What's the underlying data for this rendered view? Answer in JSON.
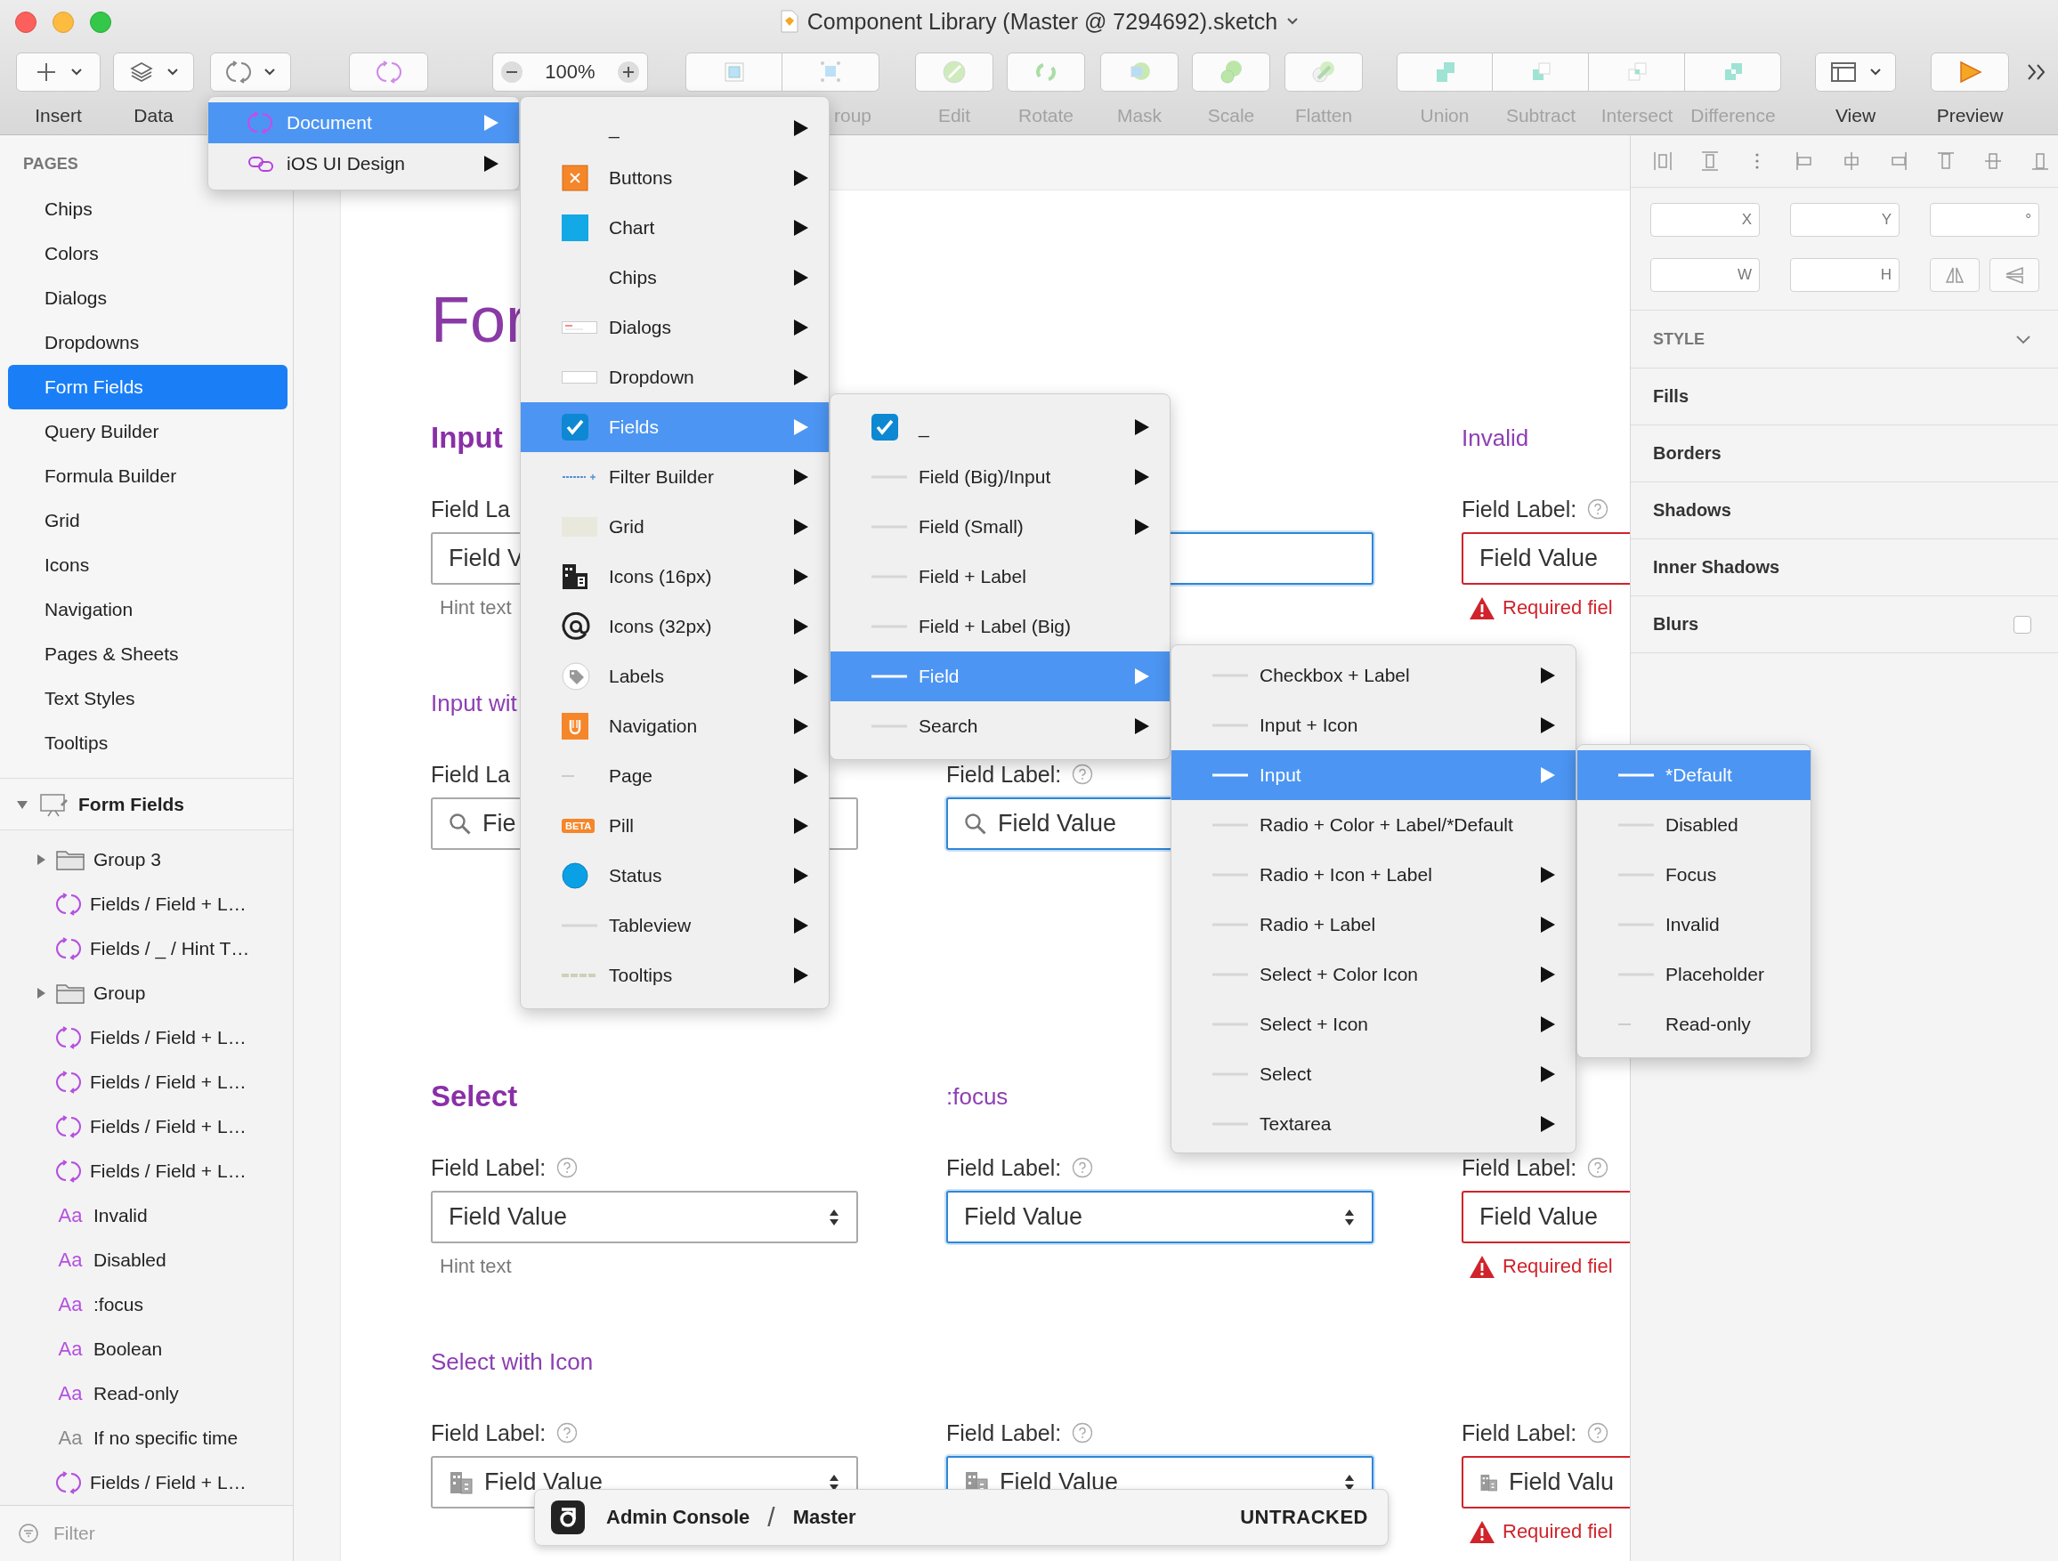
{
  "window": {
    "title": "Component Library (Master @ 7294692).sketch"
  },
  "toolbar": [
    {
      "kind": "dropdown",
      "label": "Insert",
      "disabled": false
    },
    {
      "kind": "dropdown",
      "label": "Data",
      "disabled": false
    },
    {
      "kind": "dropdown",
      "disabled": false
    },
    {
      "kind": "button",
      "disabled": false
    },
    {
      "kind": "zoom",
      "value": "100%",
      "disabled": false
    },
    {
      "kind": "pair",
      "label": "roup",
      "disabled": true
    },
    {
      "kind": "button",
      "label": "Edit",
      "disabled": true
    },
    {
      "kind": "button",
      "label": "Rotate",
      "disabled": true
    },
    {
      "kind": "button",
      "label": "Mask",
      "disabled": true
    },
    {
      "kind": "button",
      "label": "Scale",
      "disabled": true
    },
    {
      "kind": "button",
      "label": "Flatten",
      "disabled": true
    },
    {
      "kind": "segmented",
      "items": [
        {
          "label": "Union",
          "disabled": true
        },
        {
          "label": "Subtract",
          "disabled": true
        },
        {
          "label": "Intersect",
          "disabled": true
        },
        {
          "label": "Difference",
          "disabled": true
        }
      ]
    },
    {
      "kind": "dropdown",
      "label": "View",
      "disabled": false
    },
    {
      "kind": "button",
      "label": "Preview",
      "disabled": false
    },
    {
      "kind": "overflow"
    }
  ],
  "sidebar": {
    "pages_title": "PAGES",
    "pages": [
      {
        "label": "Chips",
        "selected": false
      },
      {
        "label": "Colors",
        "selected": false
      },
      {
        "label": "Dialogs",
        "selected": false
      },
      {
        "label": "Dropdowns",
        "selected": false
      },
      {
        "label": "Form Fields",
        "selected": true
      },
      {
        "label": "Query Builder",
        "selected": false
      },
      {
        "label": "Formula Builder",
        "selected": false
      },
      {
        "label": "Grid",
        "selected": false
      },
      {
        "label": "Icons",
        "selected": false
      },
      {
        "label": "Navigation",
        "selected": false
      },
      {
        "label": "Pages & Sheets",
        "selected": false
      },
      {
        "label": "Text Styles",
        "selected": false
      },
      {
        "label": "Tooltips",
        "selected": false
      }
    ],
    "layers": {
      "label": "Form Fields",
      "expanded": true,
      "children": [
        {
          "kind": "group",
          "label": "Group 3",
          "expanded": false
        },
        {
          "kind": "symbol",
          "label": "Fields / Field + L…"
        },
        {
          "kind": "symbol",
          "label": "Fields / _ / Hint T…"
        },
        {
          "kind": "group",
          "label": "Group",
          "expanded": false
        },
        {
          "kind": "symbol",
          "label": "Fields / Field + L…"
        },
        {
          "kind": "symbol",
          "label": "Fields / Field + L…"
        },
        {
          "kind": "symbol",
          "label": "Fields / Field + L…"
        },
        {
          "kind": "symbol",
          "label": "Fields / Field + L…"
        },
        {
          "kind": "text",
          "glyph": "Aa",
          "label": "Invalid",
          "dimmed": false
        },
        {
          "kind": "text",
          "glyph": "Aa",
          "label": "Disabled",
          "dimmed": false
        },
        {
          "kind": "text",
          "glyph": "Aa",
          "label": ":focus",
          "dimmed": false
        },
        {
          "kind": "text",
          "glyph": "Aa",
          "label": "Boolean",
          "dimmed": false
        },
        {
          "kind": "text",
          "glyph": "Aa",
          "label": "Read-only",
          "dimmed": false
        },
        {
          "kind": "text",
          "glyph": "Aa",
          "label": "If no specific time",
          "dimmed": true
        },
        {
          "kind": "symbol",
          "label": "Fields / Field + L…"
        }
      ]
    },
    "filter": {
      "placeholder": "Filter"
    }
  },
  "canvas": {
    "title": "For",
    "rows": [
      {
        "kind": "heading",
        "cells": [
          {
            "kind": "heading",
            "text": "Input"
          },
          {
            "kind": "blank"
          },
          {
            "kind": "subheading",
            "text": "Invalid"
          }
        ]
      },
      {
        "kind": "label",
        "cells": [
          {
            "kind": "label",
            "text": "Field La",
            "help": false
          },
          {
            "kind": "blank"
          },
          {
            "kind": "label",
            "text": "Field Label:",
            "help": true
          }
        ]
      },
      {
        "kind": "field",
        "cells": [
          {
            "kind": "input",
            "value": "Field V",
            "focus": false,
            "invalid": false
          },
          {
            "kind": "input",
            "focus": true,
            "invalid": false
          },
          {
            "kind": "input",
            "value": "Field Value",
            "focus": false,
            "invalid": true
          }
        ]
      },
      {
        "kind": "hint",
        "cells": [
          {
            "kind": "hint",
            "text": "Hint text"
          },
          {
            "kind": "blank"
          },
          {
            "kind": "error",
            "text": "Required fiel"
          }
        ]
      },
      {
        "kind": "heading",
        "cells": [
          {
            "kind": "subheading",
            "text": "Input wit"
          },
          {
            "kind": "blank"
          },
          {
            "kind": "blank"
          }
        ]
      },
      {
        "kind": "label",
        "cells": [
          {
            "kind": "label",
            "text": "Field La",
            "help": false
          },
          {
            "kind": "label",
            "text": "Field Label:",
            "help": true
          },
          {
            "kind": "blank"
          }
        ]
      },
      {
        "kind": "field",
        "cells": [
          {
            "kind": "search",
            "value": "Fie",
            "focus": false,
            "invalid": false
          },
          {
            "kind": "search",
            "value": "Field Value",
            "focus": true,
            "invalid": false
          },
          {
            "kind": "blank"
          }
        ]
      },
      {
        "kind": "heading",
        "cells": [
          {
            "kind": "heading",
            "text": "Select"
          },
          {
            "kind": "subheading",
            "text": ":focus"
          },
          {
            "kind": "blank"
          }
        ]
      },
      {
        "kind": "label",
        "cells": [
          {
            "kind": "label",
            "text": "Field Label:",
            "help": true
          },
          {
            "kind": "label",
            "text": "Field Label:",
            "help": true
          },
          {
            "kind": "label",
            "text": "Field Label:",
            "help": true
          }
        ]
      },
      {
        "kind": "field",
        "cells": [
          {
            "kind": "select",
            "value": "Field Value",
            "focus": false,
            "invalid": false
          },
          {
            "kind": "select",
            "value": "Field Value",
            "focus": true,
            "invalid": false
          },
          {
            "kind": "select",
            "value": "Field Value",
            "focus": false,
            "invalid": true
          }
        ]
      },
      {
        "kind": "hint",
        "cells": [
          {
            "kind": "hint",
            "text": "Hint text"
          },
          {
            "kind": "blank"
          },
          {
            "kind": "error",
            "text": "Required fiel"
          }
        ]
      },
      {
        "kind": "heading",
        "cells": [
          {
            "kind": "subheading",
            "text": "Select with Icon"
          },
          {
            "kind": "blank"
          },
          {
            "kind": "blank"
          }
        ]
      },
      {
        "kind": "label",
        "cells": [
          {
            "kind": "label",
            "text": "Field Label:",
            "help": true
          },
          {
            "kind": "label",
            "text": "Field Label:",
            "help": true
          },
          {
            "kind": "label",
            "text": "Field Label:",
            "help": true
          }
        ]
      },
      {
        "kind": "field",
        "cells": [
          {
            "kind": "icon-select",
            "value": "Field Value",
            "focus": false,
            "invalid": false
          },
          {
            "kind": "icon-select",
            "value": "Field Value",
            "focus": true,
            "invalid": false
          },
          {
            "kind": "icon-select",
            "value": "Field Valu",
            "focus": false,
            "invalid": true
          }
        ]
      },
      {
        "kind": "hint",
        "cells": [
          {
            "kind": "blank"
          },
          {
            "kind": "blank"
          },
          {
            "kind": "error",
            "text": "Required fiel"
          }
        ]
      }
    ]
  },
  "inspector": {
    "fields": [
      {
        "label": "X"
      },
      {
        "label": "Y"
      },
      {
        "label": "°"
      },
      {
        "label": "W"
      },
      {
        "label": "H"
      }
    ],
    "style_title": "STYLE",
    "style_expanded": true,
    "style_rows": [
      {
        "kind": "plain",
        "label": "Fills"
      },
      {
        "kind": "plain",
        "label": "Borders"
      },
      {
        "kind": "plain",
        "label": "Shadows"
      },
      {
        "kind": "plain",
        "label": "Inner Shadows"
      },
      {
        "kind": "checkbox",
        "label": "Blurs",
        "checked": false
      }
    ]
  },
  "menus": [
    {
      "items": [
        {
          "label": "Document",
          "kind": "symbol",
          "selected": true,
          "submenu": true
        },
        {
          "label": "iOS UI Design",
          "kind": "link",
          "selected": false,
          "submenu": true
        }
      ]
    },
    {
      "items": [
        {
          "label": "_",
          "kind": "none",
          "selected": false,
          "submenu": true
        },
        {
          "label": "Buttons",
          "kind": "close-tile",
          "selected": false,
          "submenu": true
        },
        {
          "label": "Chart",
          "kind": "blue-tile",
          "selected": false,
          "submenu": true
        },
        {
          "label": "Chips",
          "kind": "none",
          "selected": false,
          "submenu": true
        },
        {
          "label": "Dialogs",
          "kind": "dialog",
          "selected": false,
          "submenu": true
        },
        {
          "label": "Dropdown",
          "kind": "bar",
          "selected": false,
          "submenu": true
        },
        {
          "label": "Fields",
          "kind": "check-tile",
          "selected": true,
          "submenu": true
        },
        {
          "label": "Filter Builder",
          "kind": "tiny",
          "selected": false,
          "submenu": true
        },
        {
          "label": "Grid",
          "kind": "grid",
          "selected": false,
          "submenu": true
        },
        {
          "label": "Icons (16px)",
          "kind": "building",
          "selected": false,
          "submenu": true
        },
        {
          "label": "Icons (32px)",
          "kind": "at",
          "selected": false,
          "submenu": true
        },
        {
          "label": "Labels",
          "kind": "tag",
          "selected": false,
          "submenu": true
        },
        {
          "label": "Navigation",
          "kind": "nav",
          "selected": false,
          "submenu": true
        },
        {
          "label": "Page",
          "kind": "short-line",
          "selected": false,
          "submenu": true
        },
        {
          "label": "Pill",
          "kind": "pill",
          "badge": "BETA",
          "selected": false,
          "submenu": true
        },
        {
          "label": "Status",
          "kind": "dot",
          "selected": false,
          "submenu": true
        },
        {
          "label": "Tableview",
          "kind": "line",
          "selected": false,
          "submenu": true
        },
        {
          "label": "Tooltips",
          "kind": "dash",
          "selected": false,
          "submenu": true
        }
      ]
    },
    {
      "items": [
        {
          "label": "_",
          "kind": "check-tile",
          "selected": false,
          "submenu": true
        },
        {
          "label": "Field (Big)/Input",
          "kind": "line",
          "selected": false,
          "submenu": true
        },
        {
          "label": "Field (Small)",
          "kind": "line",
          "selected": false,
          "submenu": true
        },
        {
          "label": "Field + Label",
          "kind": "line",
          "selected": false,
          "submenu": false
        },
        {
          "label": "Field + Label (Big)",
          "kind": "line",
          "selected": false,
          "submenu": false
        },
        {
          "label": "Field",
          "kind": "line",
          "selected": true,
          "submenu": true
        },
        {
          "label": "Search",
          "kind": "line",
          "selected": false,
          "submenu": true
        }
      ]
    },
    {
      "items": [
        {
          "label": "Checkbox + Label",
          "kind": "line",
          "selected": false,
          "submenu": true
        },
        {
          "label": "Input + Icon",
          "kind": "line",
          "selected": false,
          "submenu": true
        },
        {
          "label": "Input",
          "kind": "line",
          "selected": true,
          "submenu": true
        },
        {
          "label": "Radio + Color + Label/*Default",
          "kind": "line",
          "selected": false,
          "submenu": false
        },
        {
          "label": "Radio + Icon + Label",
          "kind": "line",
          "selected": false,
          "submenu": true
        },
        {
          "label": "Radio + Label",
          "kind": "line",
          "selected": false,
          "submenu": true
        },
        {
          "label": "Select + Color Icon",
          "kind": "line",
          "selected": false,
          "submenu": true
        },
        {
          "label": "Select + Icon",
          "kind": "line",
          "selected": false,
          "submenu": true
        },
        {
          "label": "Select",
          "kind": "line",
          "selected": false,
          "submenu": true
        },
        {
          "label": "Textarea",
          "kind": "line",
          "selected": false,
          "submenu": true
        }
      ]
    },
    {
      "items": [
        {
          "label": "*Default",
          "kind": "line",
          "selected": true,
          "submenu": false
        },
        {
          "label": "Disabled",
          "kind": "line",
          "selected": false,
          "submenu": false
        },
        {
          "label": "Focus",
          "kind": "line",
          "selected": false,
          "submenu": false
        },
        {
          "label": "Invalid",
          "kind": "line",
          "selected": false,
          "submenu": false
        },
        {
          "label": "Placeholder",
          "kind": "line",
          "selected": false,
          "submenu": false
        },
        {
          "label": "Read-only",
          "kind": "short-line",
          "selected": false,
          "submenu": false
        }
      ]
    }
  ],
  "status_toast": {
    "project": "Admin Console",
    "separator": "/",
    "branch": "Master",
    "status": "UNTRACKED"
  }
}
